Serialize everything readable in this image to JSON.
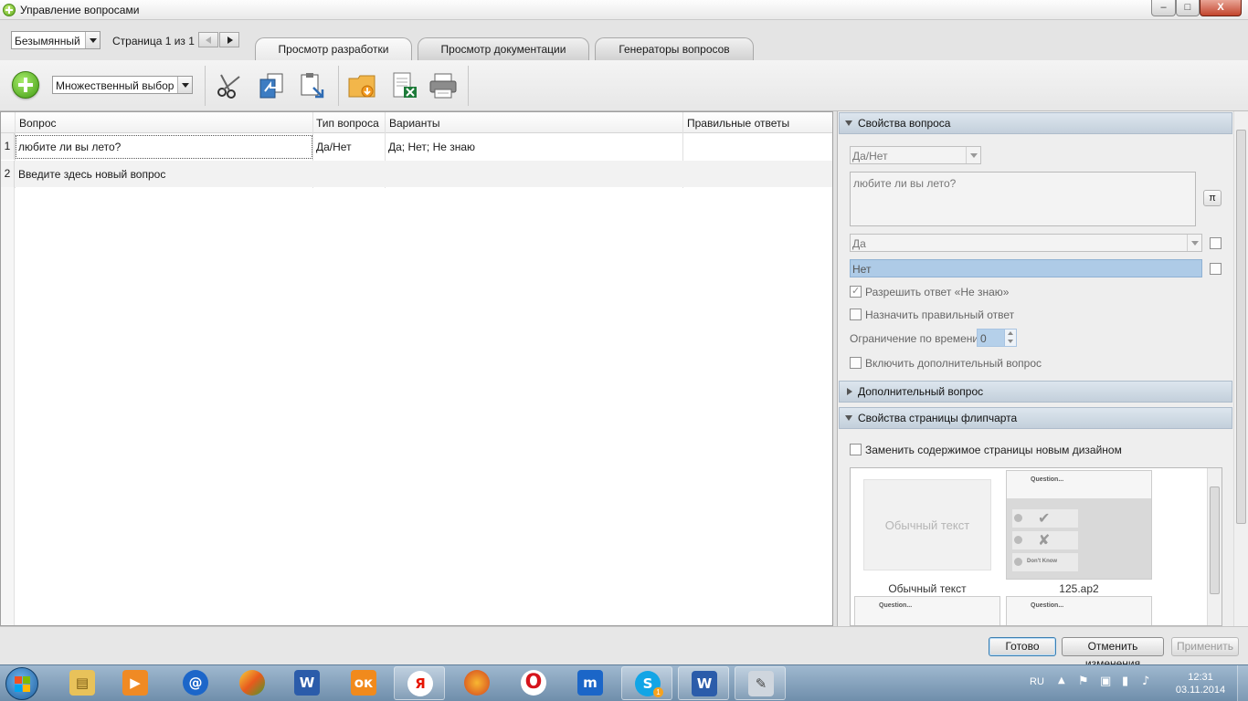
{
  "window": {
    "title": "Управление вопросами",
    "buttons": {
      "minimize": "–",
      "maximize": "□",
      "close": "X"
    }
  },
  "topbar": {
    "profile_select": "Безымянный",
    "page_label": "Страница 1 из 1",
    "tabs": [
      {
        "label": "Просмотр разработки",
        "active": true
      },
      {
        "label": "Просмотр документации",
        "active": false
      },
      {
        "label": "Генераторы вопросов",
        "active": false
      }
    ]
  },
  "toolbar": {
    "question_type_select": "Множественный выбор",
    "icons": [
      "add-icon",
      "cut-icon",
      "copy-icon",
      "paste-icon",
      "import-icon",
      "excel-icon",
      "print-icon"
    ]
  },
  "grid": {
    "columns": [
      "Вопрос",
      "Тип вопроса",
      "Варианты",
      "Правильные ответы"
    ],
    "rows": [
      {
        "num": "1",
        "question": "любите ли вы лето?",
        "type": "Да/Нет",
        "variants": "Да; Нет; Не знаю",
        "correct": ""
      },
      {
        "num": "2",
        "question": "Введите здесь новый вопрос",
        "type": "",
        "variants": "",
        "correct": ""
      }
    ]
  },
  "properties": {
    "section_title": "Свойства вопроса",
    "type_select": "Да/Нет",
    "question_text": "любите ли вы лето?",
    "pi_button": "π",
    "answer1": "Да",
    "answer2": "Нет",
    "allow_dont_know_label": "Разрешить ответ «Не знаю»",
    "assign_correct_label": "Назначить правильный ответ",
    "time_limit_label": "Ограничение по времени",
    "time_limit_value": "0",
    "include_extra_label": "Включить дополнительный вопрос"
  },
  "extra_section": {
    "title": "Дополнительный вопрос"
  },
  "flipchart": {
    "title": "Свойства страницы флипчарта",
    "replace_label": "Заменить содержимое страницы новым дизайном",
    "thumb_plain_preview": "Обычный текст",
    "thumb_plain_caption": "Обычный текст",
    "thumb_question_head": "Question...",
    "thumb_dont_know": "Don't Know",
    "thumb_q_caption": "125.ap2",
    "thumb3_head": "Question...",
    "thumb4_head": "Question..."
  },
  "footer": {
    "done": "Готово",
    "cancel_changes": "Отменить изменения",
    "apply": "Применить"
  },
  "taskbar": {
    "lang": "RU",
    "time": "12:31",
    "date": "03.11.2014",
    "skype_badge": "1"
  },
  "colors": {
    "section_header": "#c3cfdb",
    "selected_input": "#aecbe7",
    "taskbar": "#6f8eab"
  }
}
